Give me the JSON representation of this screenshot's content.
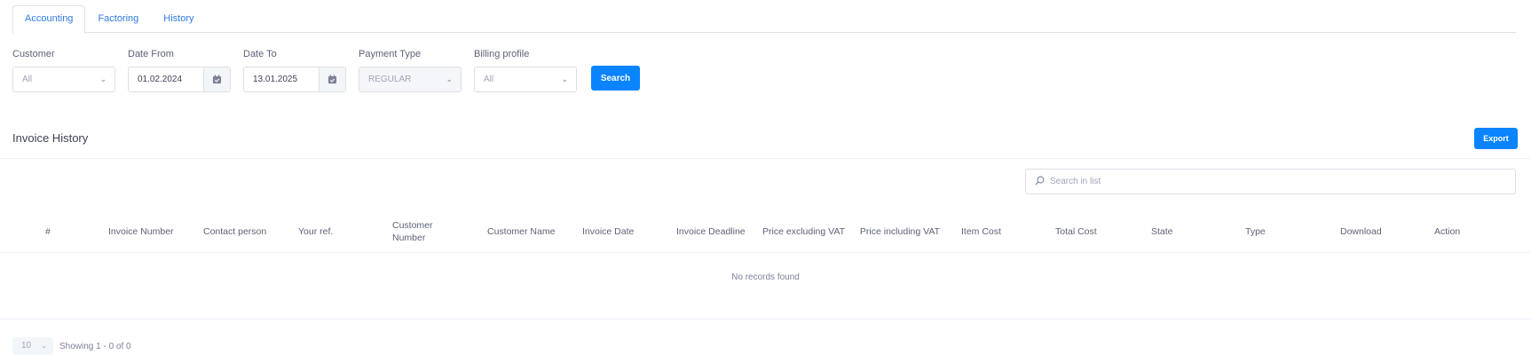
{
  "tabs": [
    {
      "label": "Accounting",
      "active": true
    },
    {
      "label": "Factoring",
      "active": false
    },
    {
      "label": "History",
      "active": false
    }
  ],
  "filters": {
    "customer": {
      "label": "Customer",
      "value": "All"
    },
    "date_from": {
      "label": "Date From",
      "value": "01.02.2024"
    },
    "date_to": {
      "label": "Date To",
      "value": "13.01.2025"
    },
    "payment_type": {
      "label": "Payment Type",
      "value": "REGULAR"
    },
    "billing_profile": {
      "label": "Billing profile",
      "value": "All"
    },
    "search_label": "Search"
  },
  "section": {
    "title": "Invoice History",
    "export_label": "Export"
  },
  "list_search": {
    "placeholder": "Search in list"
  },
  "table": {
    "columns": [
      "#",
      "Invoice Number",
      "Contact person",
      "Your ref.",
      "Customer Number",
      "Customer Name",
      "Invoice Date",
      "Invoice Deadline",
      "Price excluding VAT",
      "Price including VAT",
      "Item Cost",
      "Total Cost",
      "State",
      "Type",
      "Download",
      "Action"
    ],
    "empty_message": "No records found"
  },
  "pagination": {
    "page_size": "10",
    "info": "Showing 1 - 0 of 0"
  },
  "colors": {
    "accent": "#0a84ff",
    "tab_text": "#2f7be2",
    "border": "#dcdfe6"
  }
}
